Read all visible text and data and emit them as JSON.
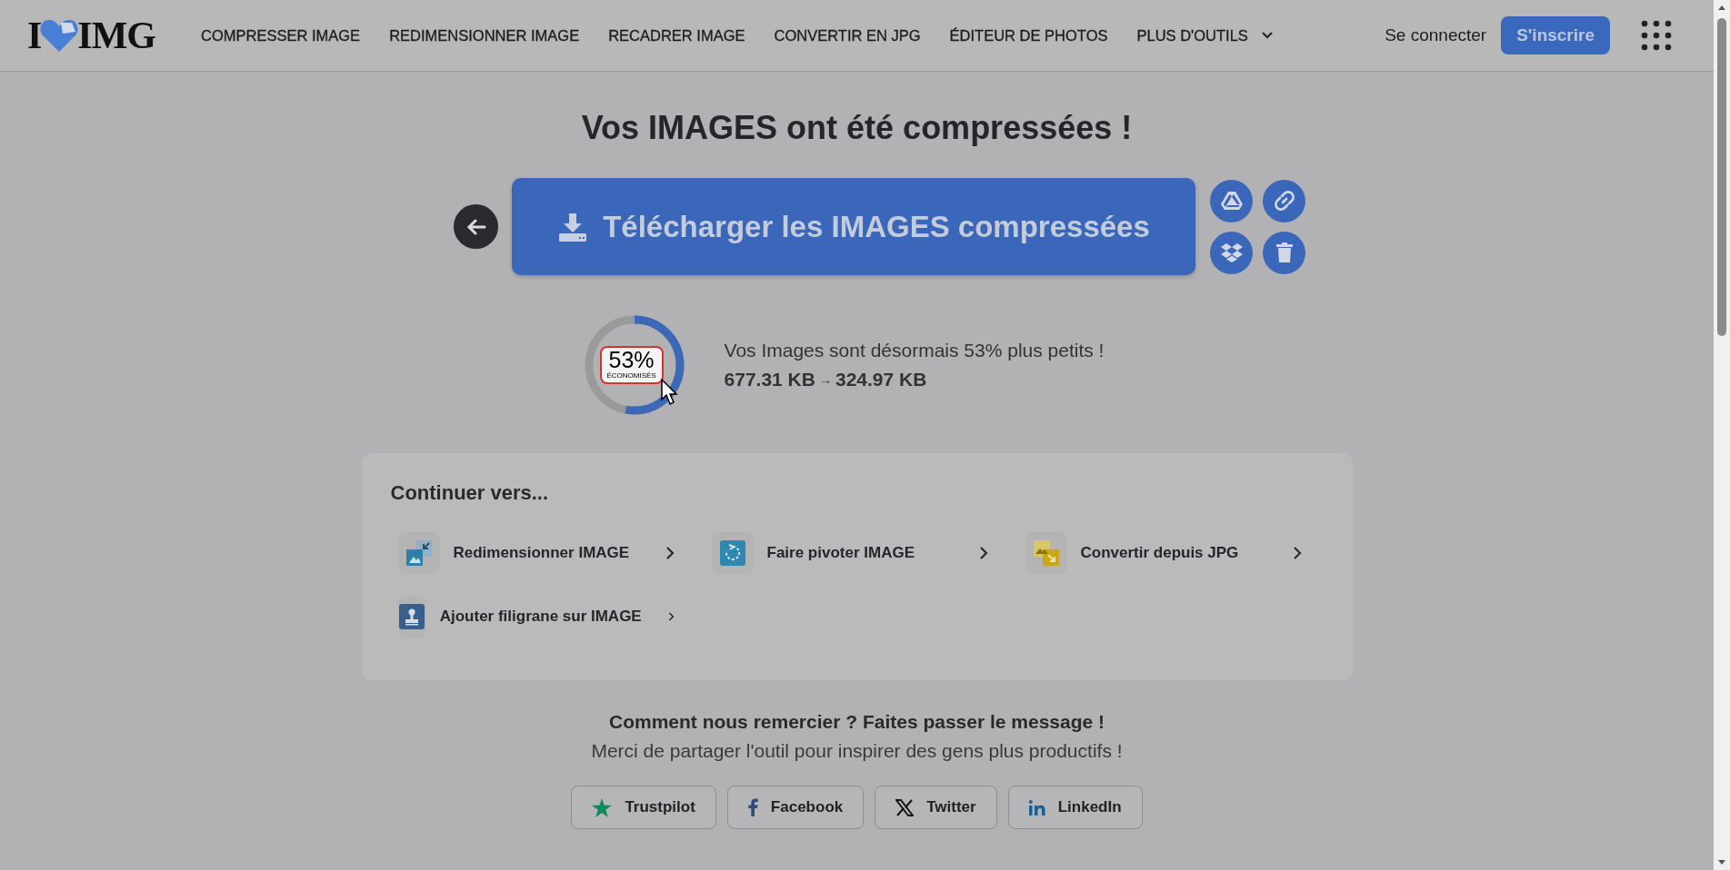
{
  "header": {
    "logo": {
      "left": "I",
      "right": "IMG"
    },
    "nav": [
      "COMPRESSER IMAGE",
      "REDIMENSIONNER IMAGE",
      "RECADRER IMAGE",
      "CONVERTIR EN JPG",
      "ÉDITEUR DE PHOTOS"
    ],
    "more": "PLUS D'OUTILS",
    "login": "Se connecter",
    "signup": "S'inscrire"
  },
  "title": "Vos IMAGES ont été compressées !",
  "download": {
    "label": "Télécharger les IMAGES compressées"
  },
  "savings": {
    "level": 0.53,
    "percent": "53%",
    "caption": "ÉCONOMISÉS",
    "message": "Vos Images sont désormais 53% plus petits !",
    "from": "677.31 KB",
    "arrow": "→",
    "to": "324.97 KB"
  },
  "continue": {
    "title": "Continuer vers...",
    "tools": [
      {
        "label": "Redimensionner IMAGE",
        "kind": "resize"
      },
      {
        "label": "Faire pivoter IMAGE",
        "kind": "rotate"
      },
      {
        "label": "Convertir depuis JPG",
        "kind": "convert"
      },
      {
        "label": "Ajouter filigrane sur IMAGE",
        "kind": "watermark"
      }
    ]
  },
  "share": {
    "title": "Comment nous remercier ? Faites passer le message !",
    "subtitle": "Merci de partager l'outil pour inspirer des gens plus productifs !",
    "buttons": [
      {
        "label": "Trustpilot",
        "kind": "trustpilot"
      },
      {
        "label": "Facebook",
        "kind": "facebook"
      },
      {
        "label": "Twitter",
        "kind": "twitter"
      },
      {
        "label": "LinkedIn",
        "kind": "linkedin"
      }
    ]
  }
}
